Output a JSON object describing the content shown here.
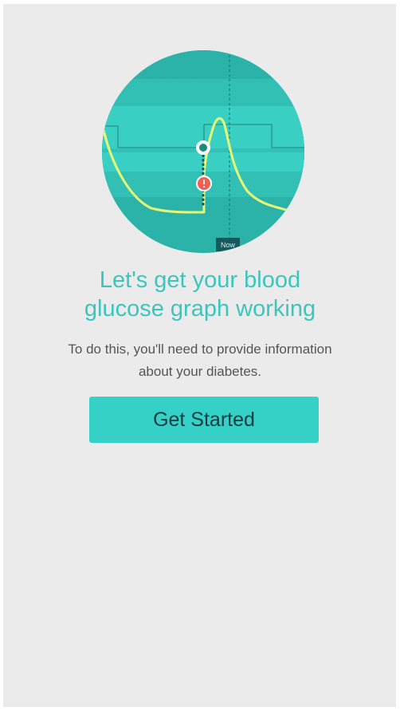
{
  "onboarding": {
    "graph": {
      "now_label": "Now",
      "colors": {
        "disc": "#2bb3a9",
        "band_light": "#39cfc3",
        "band_mid": "#32bfb4",
        "glucose_curve": "#e7fb74",
        "reading_marker_fill": "#208a82",
        "alert_marker_fill": "#f45e4f"
      }
    },
    "title_line1": "Let's get your blood",
    "title_line2": "glucose graph working",
    "description_line1": "To do this, you'll need to provide information",
    "description_line2": "about your diabetes.",
    "get_started_label": "Get Started"
  }
}
